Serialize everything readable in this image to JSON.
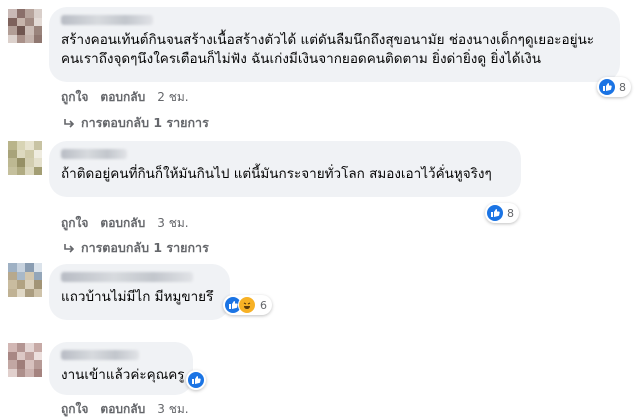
{
  "comments": [
    {
      "text_line1": "สร้างคอนเท้นต์กินจนสร้างเนื้อสร้างตัวได้ แต่ดันลืมนึกถึงสุขอนามัย ช่องนางเด็กๆดูเยอะอยู่นะ",
      "text_line2": "คนเราถึงจุดๆนึงใครเตือนก็ไม่ฟัง ฉันเก่งมีเงินจากยอดคนติดตาม ยิ่งด่ายิ่งดู ยิ่งได้เงิน",
      "like_label": "ถูกใจ",
      "reply_label": "ตอบกลับ",
      "time": "2 ชม.",
      "reaction_count": "8",
      "replies_label": "การตอบกลับ 1 รายการ"
    },
    {
      "text_line1": "ถ้าติดอยู่คนที่กินก็ให้มันกินไป แต่นี้มันกระจายทั่วโลก สมองเอาไว้คั่นหูจริงๆ",
      "like_label": "ถูกใจ",
      "reply_label": "ตอบกลับ",
      "time": "3 ชม.",
      "reaction_count": "8",
      "replies_label": "การตอบกลับ 1 รายการ"
    },
    {
      "text_line1": "แถวบ้านไม่มีไก มีหมูขายรึ",
      "reaction_count": "6"
    },
    {
      "text_line1": "งานเข้าแล้วค่ะคุณครู",
      "like_label": "ถูกใจ",
      "reply_label": "ตอบกลับ",
      "time": "3 ชม."
    }
  ],
  "colors": {
    "like_blue": "#1b74e4",
    "haha_yellow": "#f7b125",
    "bubble_bg": "#f0f2f5",
    "meta_gray": "#65676b"
  },
  "icons": [
    "like-icon",
    "haha-icon",
    "reply-arrow-icon"
  ]
}
